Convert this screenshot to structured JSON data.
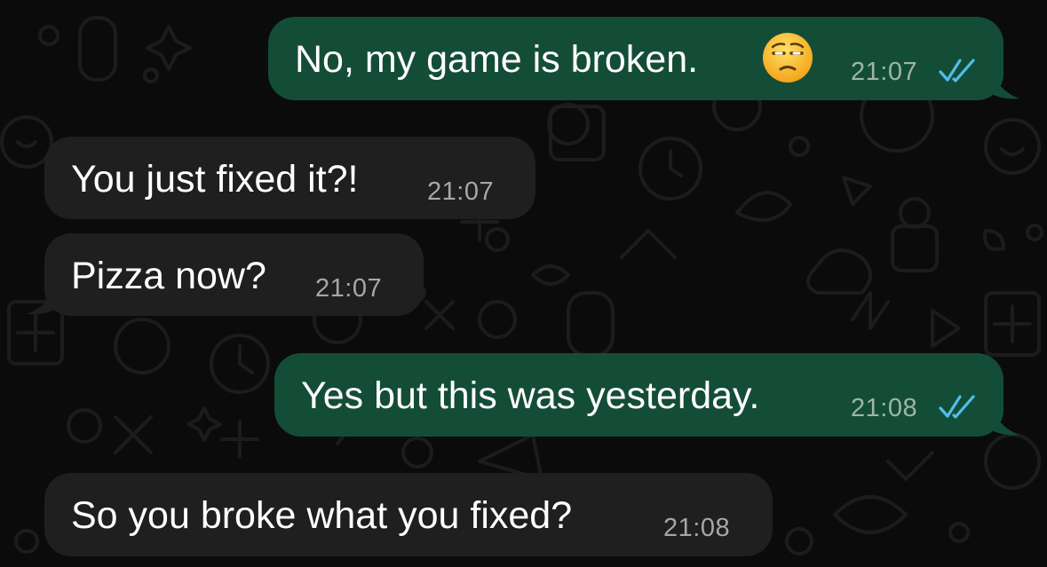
{
  "messages": [
    {
      "direction": "outgoing",
      "text": "No, my game is broken.",
      "emoji": "unamused-face",
      "time": "21:07",
      "status": "read"
    },
    {
      "direction": "incoming",
      "text": "You just fixed it?!",
      "time": "21:07"
    },
    {
      "direction": "incoming",
      "text": "Pizza now?",
      "time": "21:07"
    },
    {
      "direction": "outgoing",
      "text": "Yes but this was yesterday.",
      "time": "21:08",
      "status": "read"
    },
    {
      "direction": "incoming",
      "text": "So you broke what you fixed?",
      "time": "21:08"
    }
  ],
  "colors": {
    "outgoing_bubble": "#144d37",
    "incoming_bubble": "#1f1f1f",
    "read_ticks": "#53bdeb",
    "background": "#0b0b0b"
  }
}
